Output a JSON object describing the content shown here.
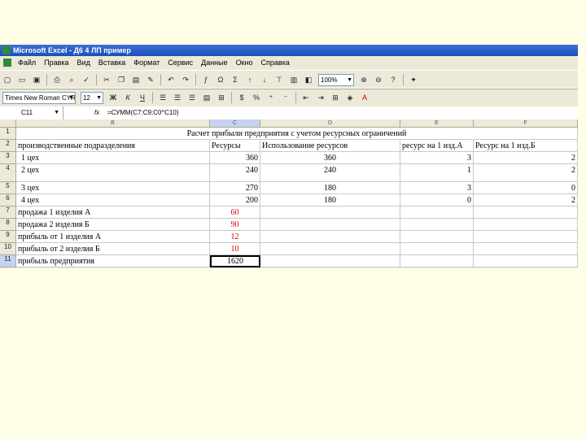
{
  "window": {
    "title": "Microsoft Excel - Д6 4 ЛП пример"
  },
  "menu": [
    "Файл",
    "Правка",
    "Вид",
    "Вставка",
    "Формат",
    "Сервис",
    "Данные",
    "Окно",
    "Справка"
  ],
  "toolbar": {
    "zoom": "100%",
    "font_name": "Times New Roman CYR",
    "font_size": "12"
  },
  "formula_bar": {
    "name_box": "C11",
    "fx": "fx",
    "formula": "=СУММ(C7:C9;C0^C10)"
  },
  "columns": [
    "B",
    "C",
    "D",
    "E",
    "F"
  ],
  "selected_column": "C",
  "rows": [
    {
      "num": "1",
      "cells": {
        "title": "Расчет прибыли предприятия с учетом ресурсных ограничений"
      }
    },
    {
      "num": "2",
      "cells": {
        "b": "производственные подразделения",
        "c": "Ресурсы",
        "d": "Использование ресурсов",
        "e": "ресурс на 1 изд.А",
        "f": "Ресурс на 1 изд.Б"
      }
    },
    {
      "num": "3",
      "cells": {
        "b": "1 цех",
        "c": "360",
        "d": "360",
        "e": "3",
        "f": "2"
      }
    },
    {
      "num": "4",
      "cells": {
        "b": "2 цех",
        "c": "240",
        "d": "240",
        "e": "1",
        "f": "2"
      }
    },
    {
      "num": "5",
      "cells": {
        "b": "3 цех",
        "c": "270",
        "d": "180",
        "e": "3",
        "f": "0"
      }
    },
    {
      "num": "6",
      "cells": {
        "b": "4 цех",
        "c": "200",
        "d": "180",
        "e": "0",
        "f": "2"
      }
    },
    {
      "num": "7",
      "cells": {
        "b": "продажа 1 изделия А",
        "c": "60"
      }
    },
    {
      "num": "8",
      "cells": {
        "b": "продажа 2 изделия Б",
        "c": "90"
      }
    },
    {
      "num": "9",
      "cells": {
        "b": "прибыль от 1 изделия А",
        "c": "12"
      }
    },
    {
      "num": "10",
      "cells": {
        "b": "прибыль от 2 изделия Б",
        "c": "10"
      }
    },
    {
      "num": "11",
      "cells": {
        "b": "прибыль предприятия",
        "c": "1620"
      }
    }
  ],
  "colors": {
    "title_bar": "#1c4fb8",
    "red_value": "#e00000",
    "page_bg": "#ffffe8"
  }
}
